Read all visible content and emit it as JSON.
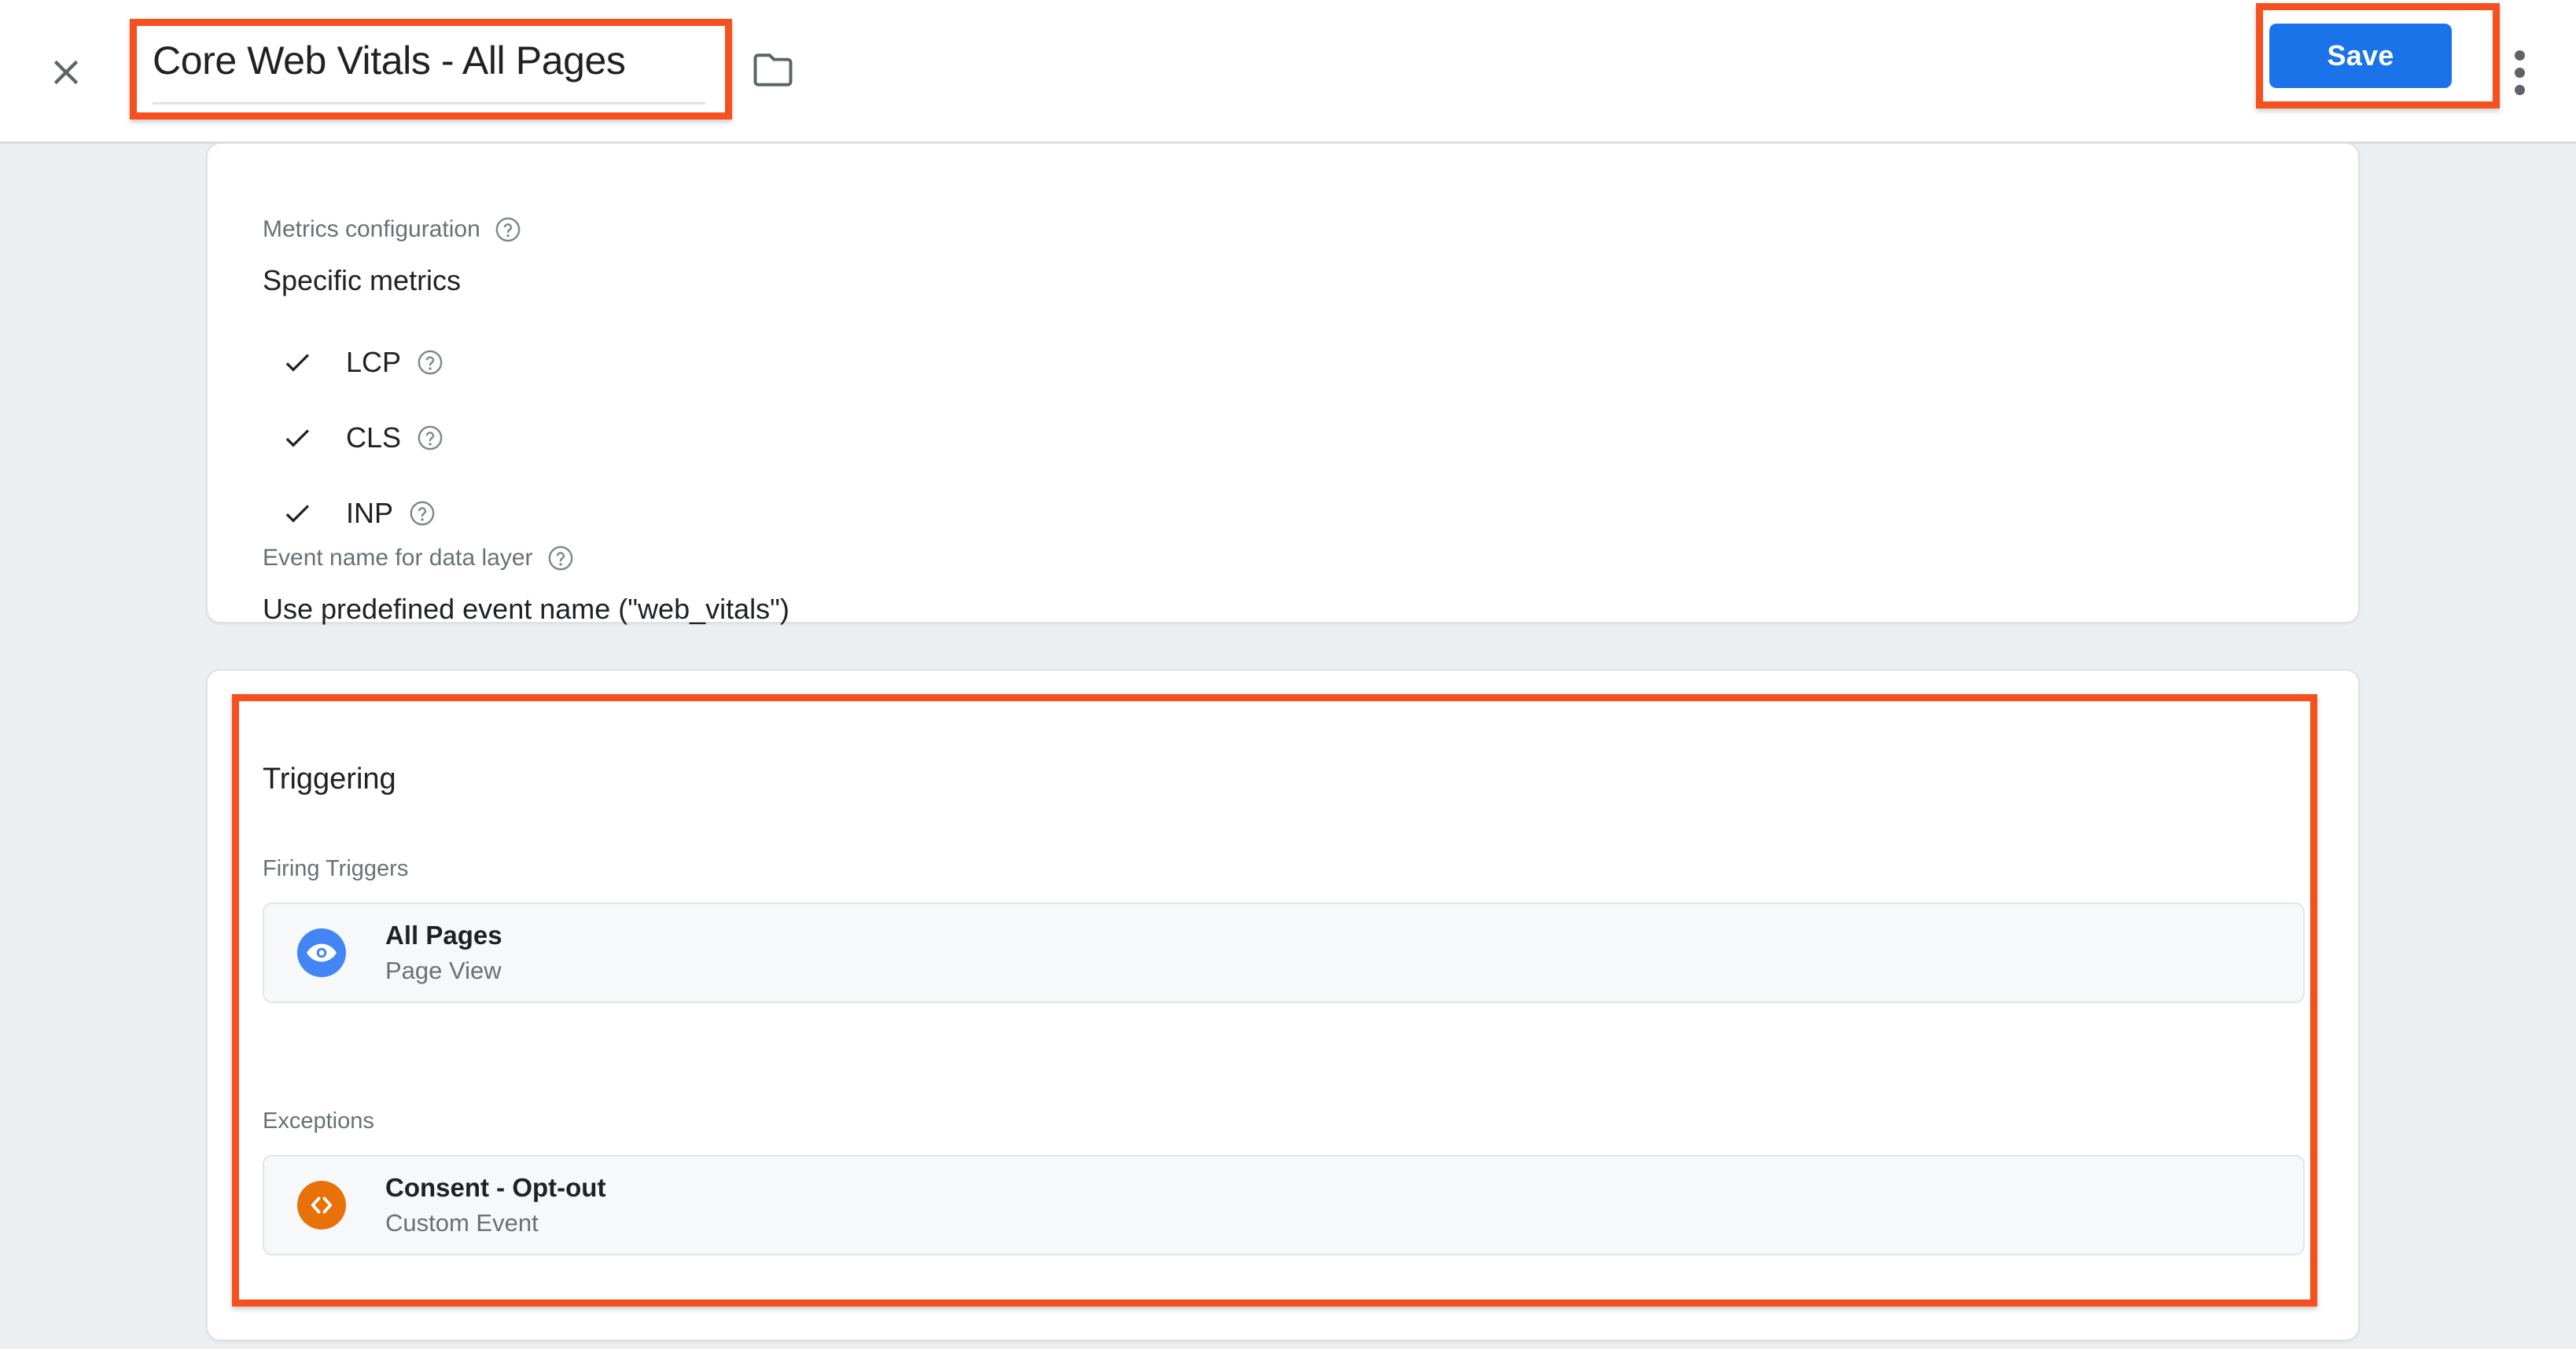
{
  "header": {
    "close_label": "Close",
    "title_value": "Core Web Vitals - All Pages",
    "title_placeholder": "Untitled Tag",
    "folder_label": "Move to folder",
    "save_label": "Save",
    "more_label": "More actions",
    "icons": {
      "close": "close-icon",
      "folder": "folder-icon",
      "more": "more-vert-icon"
    },
    "colors": {
      "save_button": "#1a73e8",
      "annotation": "#f4511e"
    }
  },
  "configuration": {
    "metrics_label": "Metrics configuration",
    "metrics_value": "Specific metrics",
    "metrics": [
      {
        "name": "LCP",
        "checked": true
      },
      {
        "name": "CLS",
        "checked": true
      },
      {
        "name": "INP",
        "checked": true
      }
    ],
    "event_name_label": "Event name for data layer",
    "event_name_value": "Use predefined event name (\"web_vitals\")"
  },
  "triggering": {
    "section_title": "Triggering",
    "firing_label": "Firing Triggers",
    "firing_triggers": [
      {
        "name": "All Pages",
        "type": "Page View",
        "icon": "eye-icon",
        "icon_color": "#4285f4"
      }
    ],
    "exceptions_label": "Exceptions",
    "exceptions": [
      {
        "name": "Consent - Opt-out",
        "type": "Custom Event",
        "icon": "code-brackets-icon",
        "icon_color": "#e8710a"
      }
    ]
  }
}
